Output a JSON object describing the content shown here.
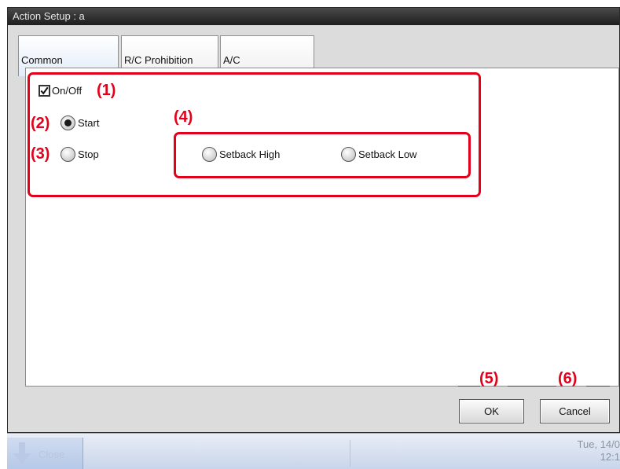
{
  "window": {
    "title": "Action Setup : a"
  },
  "tabs": [
    {
      "label": "Common",
      "active": true
    },
    {
      "label": "R/C Prohibition",
      "active": false
    },
    {
      "label": "A/C",
      "active": false
    }
  ],
  "onoff": {
    "label": "On/Off",
    "checked": true
  },
  "start": {
    "label": "Start",
    "selected": true
  },
  "stop": {
    "label": "Stop",
    "selected": false
  },
  "setback_high": {
    "label": "Setback High",
    "selected": false
  },
  "setback_low": {
    "label": "Setback Low",
    "selected": false
  },
  "callouts": {
    "c1": "(1)",
    "c2": "(2)",
    "c3": "(3)",
    "c4": "(4)",
    "c5": "(5)",
    "c6": "(6)"
  },
  "buttons": {
    "ok": "OK",
    "cancel": "Cancel"
  },
  "taskbar": {
    "down_label": "Close",
    "date": "Tue, 14/0",
    "time": "12:1"
  },
  "colors": {
    "callout_red": "#e2001a",
    "titlebar": "#2a2a2a",
    "panel_bg": "#dcdcdc"
  }
}
